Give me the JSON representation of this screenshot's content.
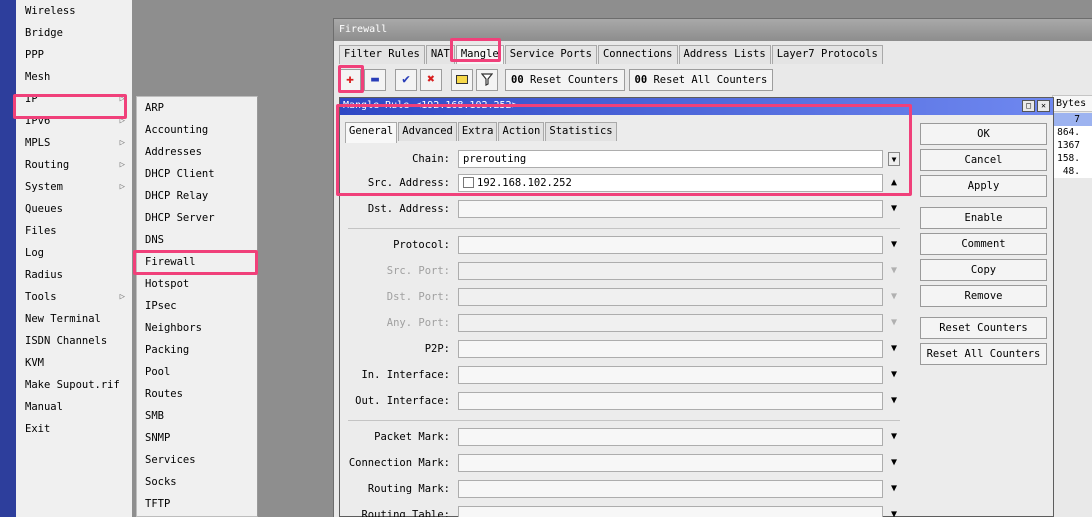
{
  "main_menu": {
    "items": [
      {
        "label": "Wireless",
        "arrow": false
      },
      {
        "label": "Bridge",
        "arrow": false
      },
      {
        "label": "PPP",
        "arrow": false
      },
      {
        "label": "Mesh",
        "arrow": false
      },
      {
        "label": "IP",
        "arrow": true
      },
      {
        "label": "IPv6",
        "arrow": true
      },
      {
        "label": "MPLS",
        "arrow": true
      },
      {
        "label": "Routing",
        "arrow": true
      },
      {
        "label": "System",
        "arrow": true
      },
      {
        "label": "Queues",
        "arrow": false
      },
      {
        "label": "Files",
        "arrow": false
      },
      {
        "label": "Log",
        "arrow": false
      },
      {
        "label": "Radius",
        "arrow": false
      },
      {
        "label": "Tools",
        "arrow": true
      },
      {
        "label": "New Terminal",
        "arrow": false
      },
      {
        "label": "ISDN Channels",
        "arrow": false
      },
      {
        "label": "KVM",
        "arrow": false
      },
      {
        "label": "Make Supout.rif",
        "arrow": false
      },
      {
        "label": "Manual",
        "arrow": false
      },
      {
        "label": "Exit",
        "arrow": false
      }
    ]
  },
  "ip_submenu": {
    "items": [
      "ARP",
      "Accounting",
      "Addresses",
      "DHCP Client",
      "DHCP Relay",
      "DHCP Server",
      "DNS",
      "Firewall",
      "Hotspot",
      "IPsec",
      "Neighbors",
      "Packing",
      "Pool",
      "Routes",
      "SMB",
      "SNMP",
      "Services",
      "Socks",
      "TFTP"
    ]
  },
  "firewall": {
    "title": "Firewall",
    "tabs": [
      "Filter Rules",
      "NAT",
      "Mangle",
      "Service Ports",
      "Connections",
      "Address Lists",
      "Layer7 Protocols"
    ],
    "toolbar": {
      "reset_counters": "Reset Counters",
      "reset_all_counters": "Reset All Counters",
      "counter_prefix": "00"
    },
    "column_header": "Bytes",
    "bytes_values": [
      "7",
      "864.",
      "1367",
      "158.",
      "48."
    ]
  },
  "dialog": {
    "title": "Mangle Rule <192.168.102.252>",
    "tabs": [
      "General",
      "Advanced",
      "Extra",
      "Action",
      "Statistics"
    ],
    "fields": {
      "chain": {
        "label": "Chain:",
        "value": "prerouting"
      },
      "src_address": {
        "label": "Src. Address:",
        "value": "192.168.102.252"
      },
      "dst_address": {
        "label": "Dst. Address:",
        "value": ""
      },
      "protocol": {
        "label": "Protocol:",
        "value": ""
      },
      "src_port": {
        "label": "Src. Port:",
        "value": ""
      },
      "dst_port": {
        "label": "Dst. Port:",
        "value": ""
      },
      "any_port": {
        "label": "Any. Port:",
        "value": ""
      },
      "p2p": {
        "label": "P2P:",
        "value": ""
      },
      "in_interface": {
        "label": "In. Interface:",
        "value": ""
      },
      "out_interface": {
        "label": "Out. Interface:",
        "value": ""
      },
      "packet_mark": {
        "label": "Packet Mark:",
        "value": ""
      },
      "connection_mark": {
        "label": "Connection Mark:",
        "value": ""
      },
      "routing_mark": {
        "label": "Routing Mark:",
        "value": ""
      },
      "routing_table": {
        "label": "Routing Table:",
        "value": ""
      }
    },
    "buttons": [
      "OK",
      "Cancel",
      "Apply",
      "Enable",
      "Comment",
      "Copy",
      "Remove",
      "Reset Counters",
      "Reset All Counters"
    ]
  },
  "colors": {
    "highlight": "#f0407a",
    "sidebar": "#2d3e9c",
    "dialog_title": "#2e48c5",
    "selected_row": "#9db3f0"
  }
}
